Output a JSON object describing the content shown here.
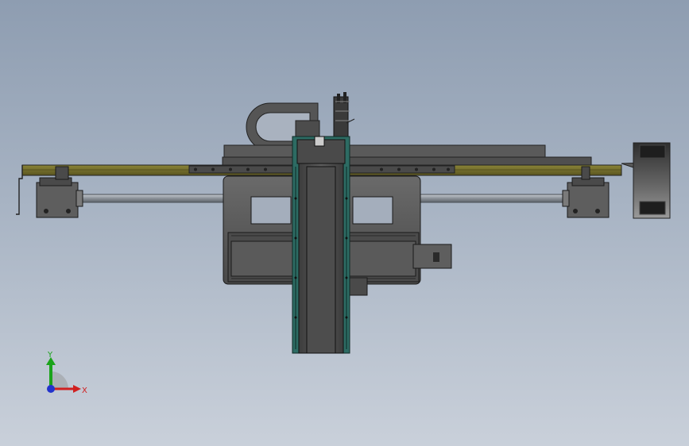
{
  "viewport": {
    "background_top": "#8e9db1",
    "background_bottom": "#c9d0da"
  },
  "model": {
    "steel_color": "#555555",
    "steel_dark": "#2f2f2f",
    "rail_color": "#6f6a2a",
    "accent_color": "#2d6b63",
    "shaft_color": "#9aa0a8"
  },
  "triad": {
    "y_label": "Y",
    "x_label": "X",
    "y_color": "#1aa31a",
    "x_color": "#d02020",
    "z_color": "#2233cc"
  }
}
